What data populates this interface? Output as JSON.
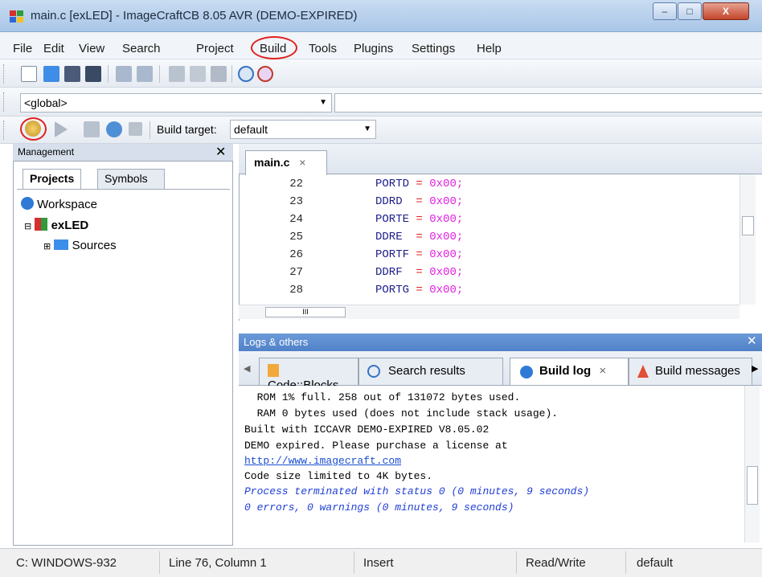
{
  "window": {
    "title": "main.c [exLED] - ImageCraftCB 8.05 AVR (DEMO-EXPIRED)",
    "minimize": "–",
    "maximize": "□",
    "close": "X"
  },
  "menu": {
    "items": [
      "File",
      "Edit",
      "View",
      "Search",
      "Project",
      "Build",
      "Tools",
      "Plugins",
      "Settings",
      "Help"
    ],
    "highlighted": "Build"
  },
  "toolbar": {
    "scope_combo": "<global>",
    "build_target_label": "Build target:",
    "build_target_value": "default"
  },
  "management": {
    "title": "Management",
    "close": "✕",
    "tabs": [
      "Projects",
      "Symbols"
    ],
    "active_tab": "Projects",
    "tree": {
      "workspace": "Workspace",
      "project": "exLED",
      "folder": "Sources"
    }
  },
  "editor": {
    "tab_label": "main.c",
    "tab_close": "×",
    "lines": [
      {
        "num": "22",
        "reg": "PORTD",
        "val": "0x00;"
      },
      {
        "num": "23",
        "reg": "DDRD ",
        "val": "0x00;"
      },
      {
        "num": "24",
        "reg": "PORTE",
        "val": "0x00;"
      },
      {
        "num": "25",
        "reg": "DDRE ",
        "val": "0x00;"
      },
      {
        "num": "26",
        "reg": "PORTF",
        "val": "0x00;"
      },
      {
        "num": "27",
        "reg": "DDRF ",
        "val": "0x00;"
      },
      {
        "num": "28",
        "reg": "PORTG",
        "val": "0x00;"
      }
    ],
    "hscroll_thumb": "III"
  },
  "logs": {
    "title": "Logs & others",
    "close": "✕",
    "tabs": [
      "Code::Blocks",
      "Search results",
      "Build log",
      "Build messages"
    ],
    "active_tab": "Build log",
    "active_tab_close": "×",
    "lines": [
      {
        "text": "  ROM 1% full. 258 out of 131072 bytes used.",
        "style": "normal"
      },
      {
        "text": "  RAM 0 bytes used (does not include stack usage).",
        "style": "normal"
      },
      {
        "text": "Built with ICCAVR DEMO-EXPIRED V8.05.02",
        "style": "normal"
      },
      {
        "text": "DEMO expired. Please purchase a license at",
        "style": "normal"
      },
      {
        "text": "http://www.imagecraft.com",
        "style": "link"
      },
      {
        "text": "Code size limited to 4K bytes.",
        "style": "normal"
      },
      {
        "text": "Process terminated with status 0 (0 minutes, 9 seconds)",
        "style": "blue"
      },
      {
        "text": "0 errors, 0 warnings (0 minutes, 9 seconds)",
        "style": "blue"
      }
    ]
  },
  "statusbar": {
    "encoding": "C: WINDOWS-932",
    "position": "Line 76, Column 1",
    "mode": "Insert",
    "access": "Read/Write",
    "profile": "default"
  },
  "colors": {
    "highlight_ring": "#e0201f",
    "log_blue": "#1f3fd6",
    "code_number": "#e020e0",
    "code_register": "#1c1c8a"
  }
}
